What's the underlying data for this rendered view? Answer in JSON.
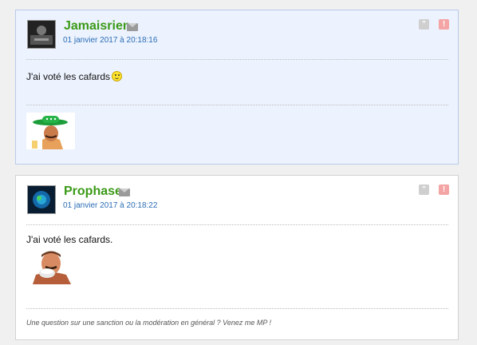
{
  "posts": [
    {
      "author": "Jamaisrien",
      "date": "01 janvier 2017 à 20:18:16",
      "message": "J'ai voté les cafards",
      "icons": [
        "mail-icon",
        "quote-icon",
        "alert-icon"
      ],
      "quote_symbol": "”",
      "alert_symbol": "!"
    },
    {
      "author": "Prophase",
      "date": "01 janvier 2017 à 20:18:22",
      "message": "J'ai voté les cafards.",
      "signature": "Une question sur une sanction ou la modération en général ? Venez me MP !",
      "icons": [
        "mail-icon",
        "quote-icon",
        "alert-icon"
      ],
      "quote_symbol": "”",
      "alert_symbol": "!"
    }
  ],
  "colors": {
    "author": "#3c9a18",
    "date": "#2a6db5",
    "highlight_bg": "#ecf2fe",
    "alert": "#f4a4a4",
    "quote": "#cfcfcf"
  }
}
